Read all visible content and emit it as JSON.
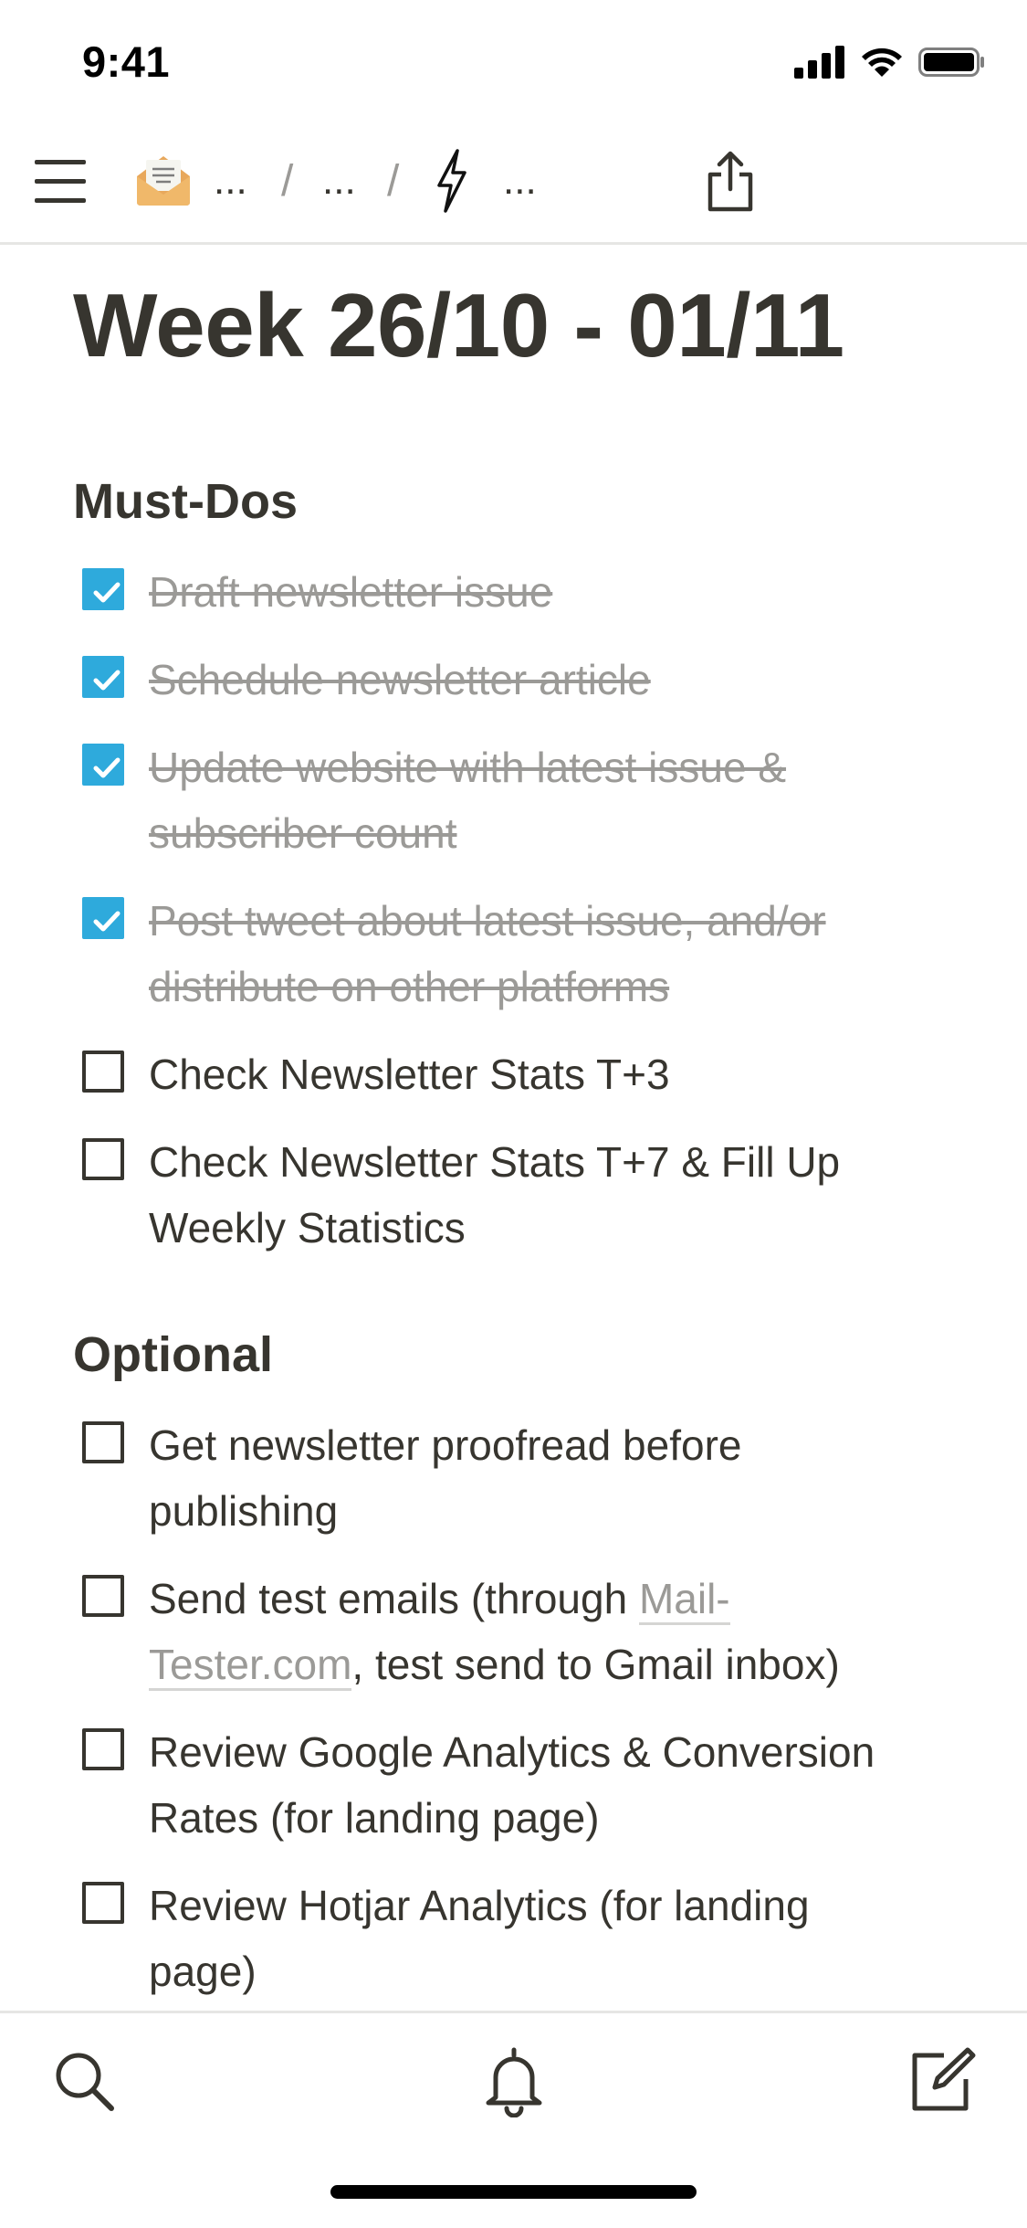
{
  "status_bar": {
    "time": "9:41"
  },
  "nav": {
    "breadcrumbs": [
      "...",
      "...",
      "..."
    ],
    "separator": "/"
  },
  "page": {
    "title": "Week 26/10 - 01/11"
  },
  "sections": {
    "must_dos": {
      "heading": "Must-Dos",
      "items": [
        {
          "line1": "Draft newsletter issue",
          "line2": "",
          "checked": true
        },
        {
          "line1": "Schedule newsletter article",
          "line2": "",
          "checked": true
        },
        {
          "line1": "Update website with latest issue &",
          "line2": "subscriber count",
          "checked": true
        },
        {
          "line1": "Post tweet about latest issue, and/or",
          "line2": "distribute on other platforms",
          "checked": true
        },
        {
          "line1": "Check Newsletter Stats T+3",
          "line2": "",
          "checked": false
        },
        {
          "line1": "Check Newsletter Stats T+7 & Fill Up",
          "line2": "Weekly Statistics",
          "checked": false
        }
      ]
    },
    "optional": {
      "heading": "Optional",
      "items": [
        {
          "line1": "Get newsletter proofread before",
          "line2": "publishing",
          "checked": false
        },
        {
          "line1_pre": "Send test emails (through ",
          "link_part1": "Mail-",
          "link_part2": "Tester.com",
          "line2_post": ", test send to Gmail inbox)",
          "checked": false
        },
        {
          "line1": "Review Google Analytics & Conversion",
          "line2": "Rates (for landing page)",
          "checked": false
        },
        {
          "line1": "Review Hotjar Analytics (for landing",
          "line2": "page)",
          "checked": false
        }
      ]
    }
  },
  "bottom_bar": {
    "icons": [
      "search-icon",
      "bell-icon",
      "compose-icon"
    ]
  },
  "colors": {
    "text": "#37352f",
    "done_text": "#9b9a97",
    "checkbox_checked": "#2eaadc",
    "divider": "#e6e6e4"
  }
}
